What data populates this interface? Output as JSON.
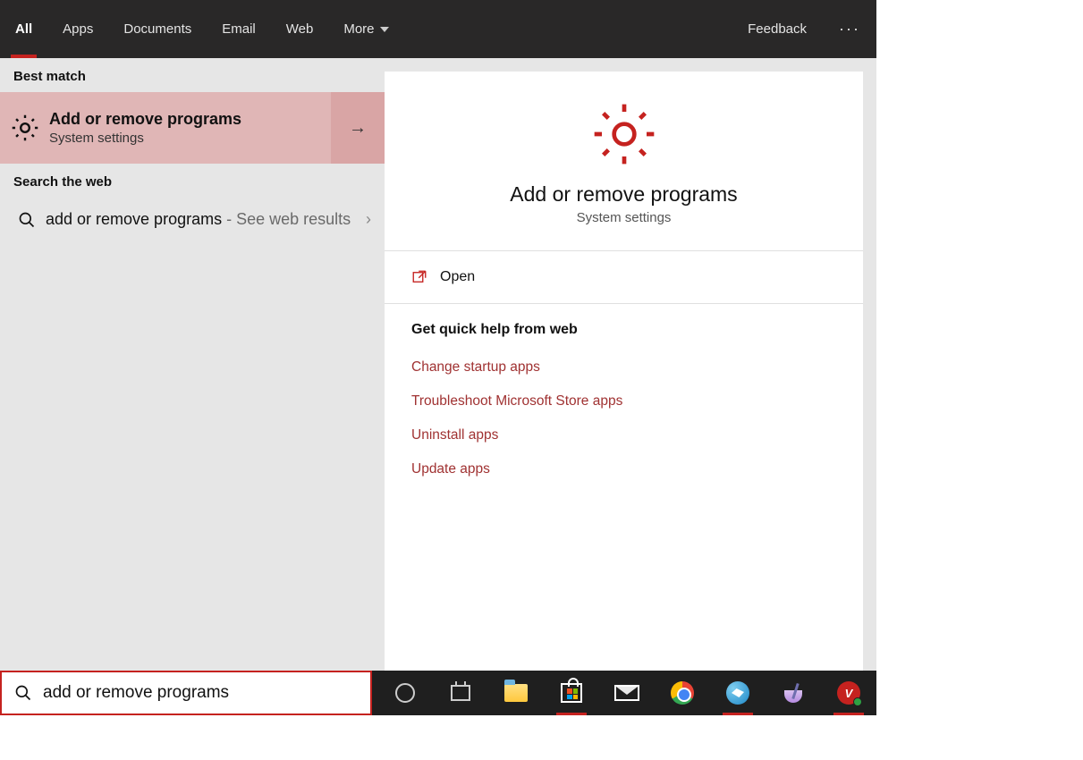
{
  "topbar": {
    "tabs": [
      "All",
      "Apps",
      "Documents",
      "Email",
      "Web",
      "More"
    ],
    "feedback": "Feedback"
  },
  "left": {
    "best_match_label": "Best match",
    "best_match_title": "Add or remove programs",
    "best_match_subtitle": "System settings",
    "search_web_label": "Search the web",
    "web_query": "add or remove programs",
    "web_suffix": " - See web results"
  },
  "detail": {
    "title": "Add or remove programs",
    "subtitle": "System settings",
    "open_label": "Open",
    "help_title": "Get quick help from web",
    "help_links": [
      "Change startup apps",
      "Troubleshoot Microsoft Store apps",
      "Uninstall apps",
      "Update apps"
    ]
  },
  "search": {
    "value": "add or remove programs"
  }
}
